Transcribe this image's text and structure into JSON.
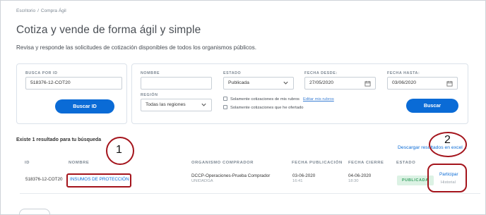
{
  "breadcrumb": {
    "items": [
      "Escritorio",
      "Compra Ágil"
    ],
    "separator": "/"
  },
  "page": {
    "title": "Cotiza y vende de forma ágil y simple",
    "subtitle": "Revisa y responde las solicitudes de cotización disponibles de todos los organismos públicos."
  },
  "search_id": {
    "label": "BUSCA POR ID",
    "value": "518376-12-COT20",
    "button": "Buscar ID"
  },
  "filters": {
    "nombre_label": "NOMBRE",
    "nombre_value": "",
    "estado_label": "ESTADO",
    "estado_value": "Publicada",
    "fecha_desde_label": "FECHA DESDE:",
    "fecha_desde_value": "27/05/2020",
    "fecha_hasta_label": "FECHA HASTA:",
    "fecha_hasta_value": "03/06/2020",
    "region_label": "REGIÓN",
    "region_value": "Todas las regiones",
    "check_rubros": "Solamente cotizaciones de mis rubros",
    "edit_rubros": "Editar mis rubros",
    "check_no_ofertado": "Solamente cotizaciones que he ofertado",
    "button": "Buscar"
  },
  "results": {
    "count_text": "Existe 1 resultado para tu búsqueda",
    "download": "Descargar resultados en excel",
    "headers": [
      "ID",
      "NOMBRE",
      "ORGANISMO COMPRADOR",
      "FECHA PUBLICACIÓN",
      "FECHA CIERRE",
      "ESTADO"
    ],
    "rows": [
      {
        "id": "518376-12-COT20",
        "nombre": "INSUMOS DE PROTECCIÓN",
        "organismo": "DCCP-Operaciones-Prueba Comprador",
        "unidad": "UNIDADGA",
        "fecha_pub": "03-06-2020",
        "hora_pub": "16:41",
        "fecha_cierre": "04-06-2020",
        "hora_cierre": "18:30",
        "estado": "PUBLICADA",
        "action_participar": "Participar",
        "action_historial": "Historial"
      }
    ]
  },
  "annotations": {
    "marker1": "1",
    "marker2": "2",
    "color": "#a4141c"
  },
  "colors": {
    "primary": "#0a6bd6",
    "badge_bg": "#dcf2e4",
    "badge_text": "#3aa364"
  }
}
